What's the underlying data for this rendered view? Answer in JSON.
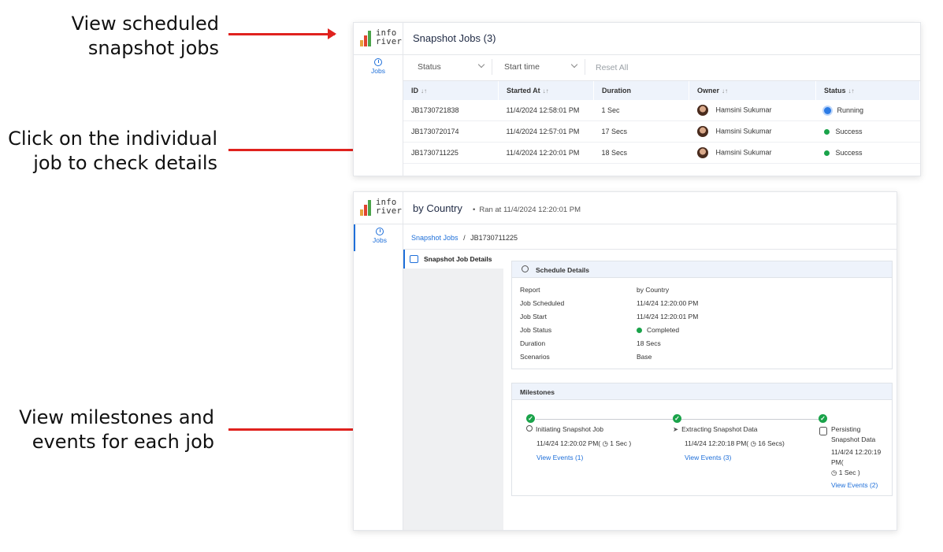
{
  "callouts": {
    "c1_line1": "View scheduled",
    "c1_line2": "snapshot jobs",
    "c2_line1": "Click on the individual",
    "c2_line2": "job to check details",
    "c3_line1": "View milestones and",
    "c3_line2": "events for each job"
  },
  "logo": {
    "line1": "info",
    "line2": "river"
  },
  "rail": {
    "jobs_label": "Jobs"
  },
  "jobs_view": {
    "title": "Snapshot Jobs (3)",
    "filters": {
      "status": "Status",
      "start_time": "Start time",
      "reset": "Reset All"
    },
    "columns": {
      "id": "ID",
      "started_at": "Started At",
      "duration": "Duration",
      "owner": "Owner",
      "status": "Status"
    },
    "sort_glyph": "↓↑",
    "rows": [
      {
        "id": "JB1730721838",
        "started_at": "11/4/2024 12:58:01 PM",
        "duration": "1 Sec",
        "owner": "Hamsini Sukumar",
        "status": "Running"
      },
      {
        "id": "JB1730720174",
        "started_at": "11/4/2024 12:57:01 PM",
        "duration": "17 Secs",
        "owner": "Hamsini Sukumar",
        "status": "Success"
      },
      {
        "id": "JB1730711225",
        "started_at": "11/4/2024 12:20:01 PM",
        "duration": "18 Secs",
        "owner": "Hamsini Sukumar",
        "status": "Success"
      }
    ]
  },
  "detail_view": {
    "title": "by Country",
    "subtitle": "Ran at 11/4/2024 12:20:01 PM",
    "breadcrumb": {
      "root": "Snapshot Jobs",
      "sep": "/",
      "current": "JB1730711225"
    },
    "side_tab": "Snapshot Job Details",
    "schedule": {
      "heading": "Schedule Details",
      "rows": [
        {
          "label": "Report",
          "value": "by Country"
        },
        {
          "label": "Job Scheduled",
          "value": "11/4/24 12:20:00 PM"
        },
        {
          "label": "Job Start",
          "value": "11/4/24 12:20:01 PM"
        },
        {
          "label": "Job Status",
          "value": "Completed"
        },
        {
          "label": "Duration",
          "value": "18 Secs"
        },
        {
          "label": "Scenarios",
          "value": "Base"
        }
      ]
    },
    "milestones": {
      "heading": "Milestones",
      "items": [
        {
          "name": "Initiating Snapshot Job",
          "time": "11/4/24 12:20:02 PM( ◷ 1 Sec )",
          "link": "View Events (1)"
        },
        {
          "name": "Extracting Snapshot Data",
          "time": "11/4/24 12:20:18 PM( ◷ 16 Secs)",
          "link": "View Events (3)"
        },
        {
          "name_l1": "Persisting",
          "name_l2": "Snapshot Data",
          "time_l1": "11/4/24 12:20:19",
          "time_l2": "PM(",
          "time_l3": "◷ 1 Sec )",
          "link": "View Events (2)"
        }
      ]
    }
  },
  "colors": {
    "accent": "#1e6fd9",
    "success": "#1aa34a",
    "arrow": "#e0221e"
  }
}
